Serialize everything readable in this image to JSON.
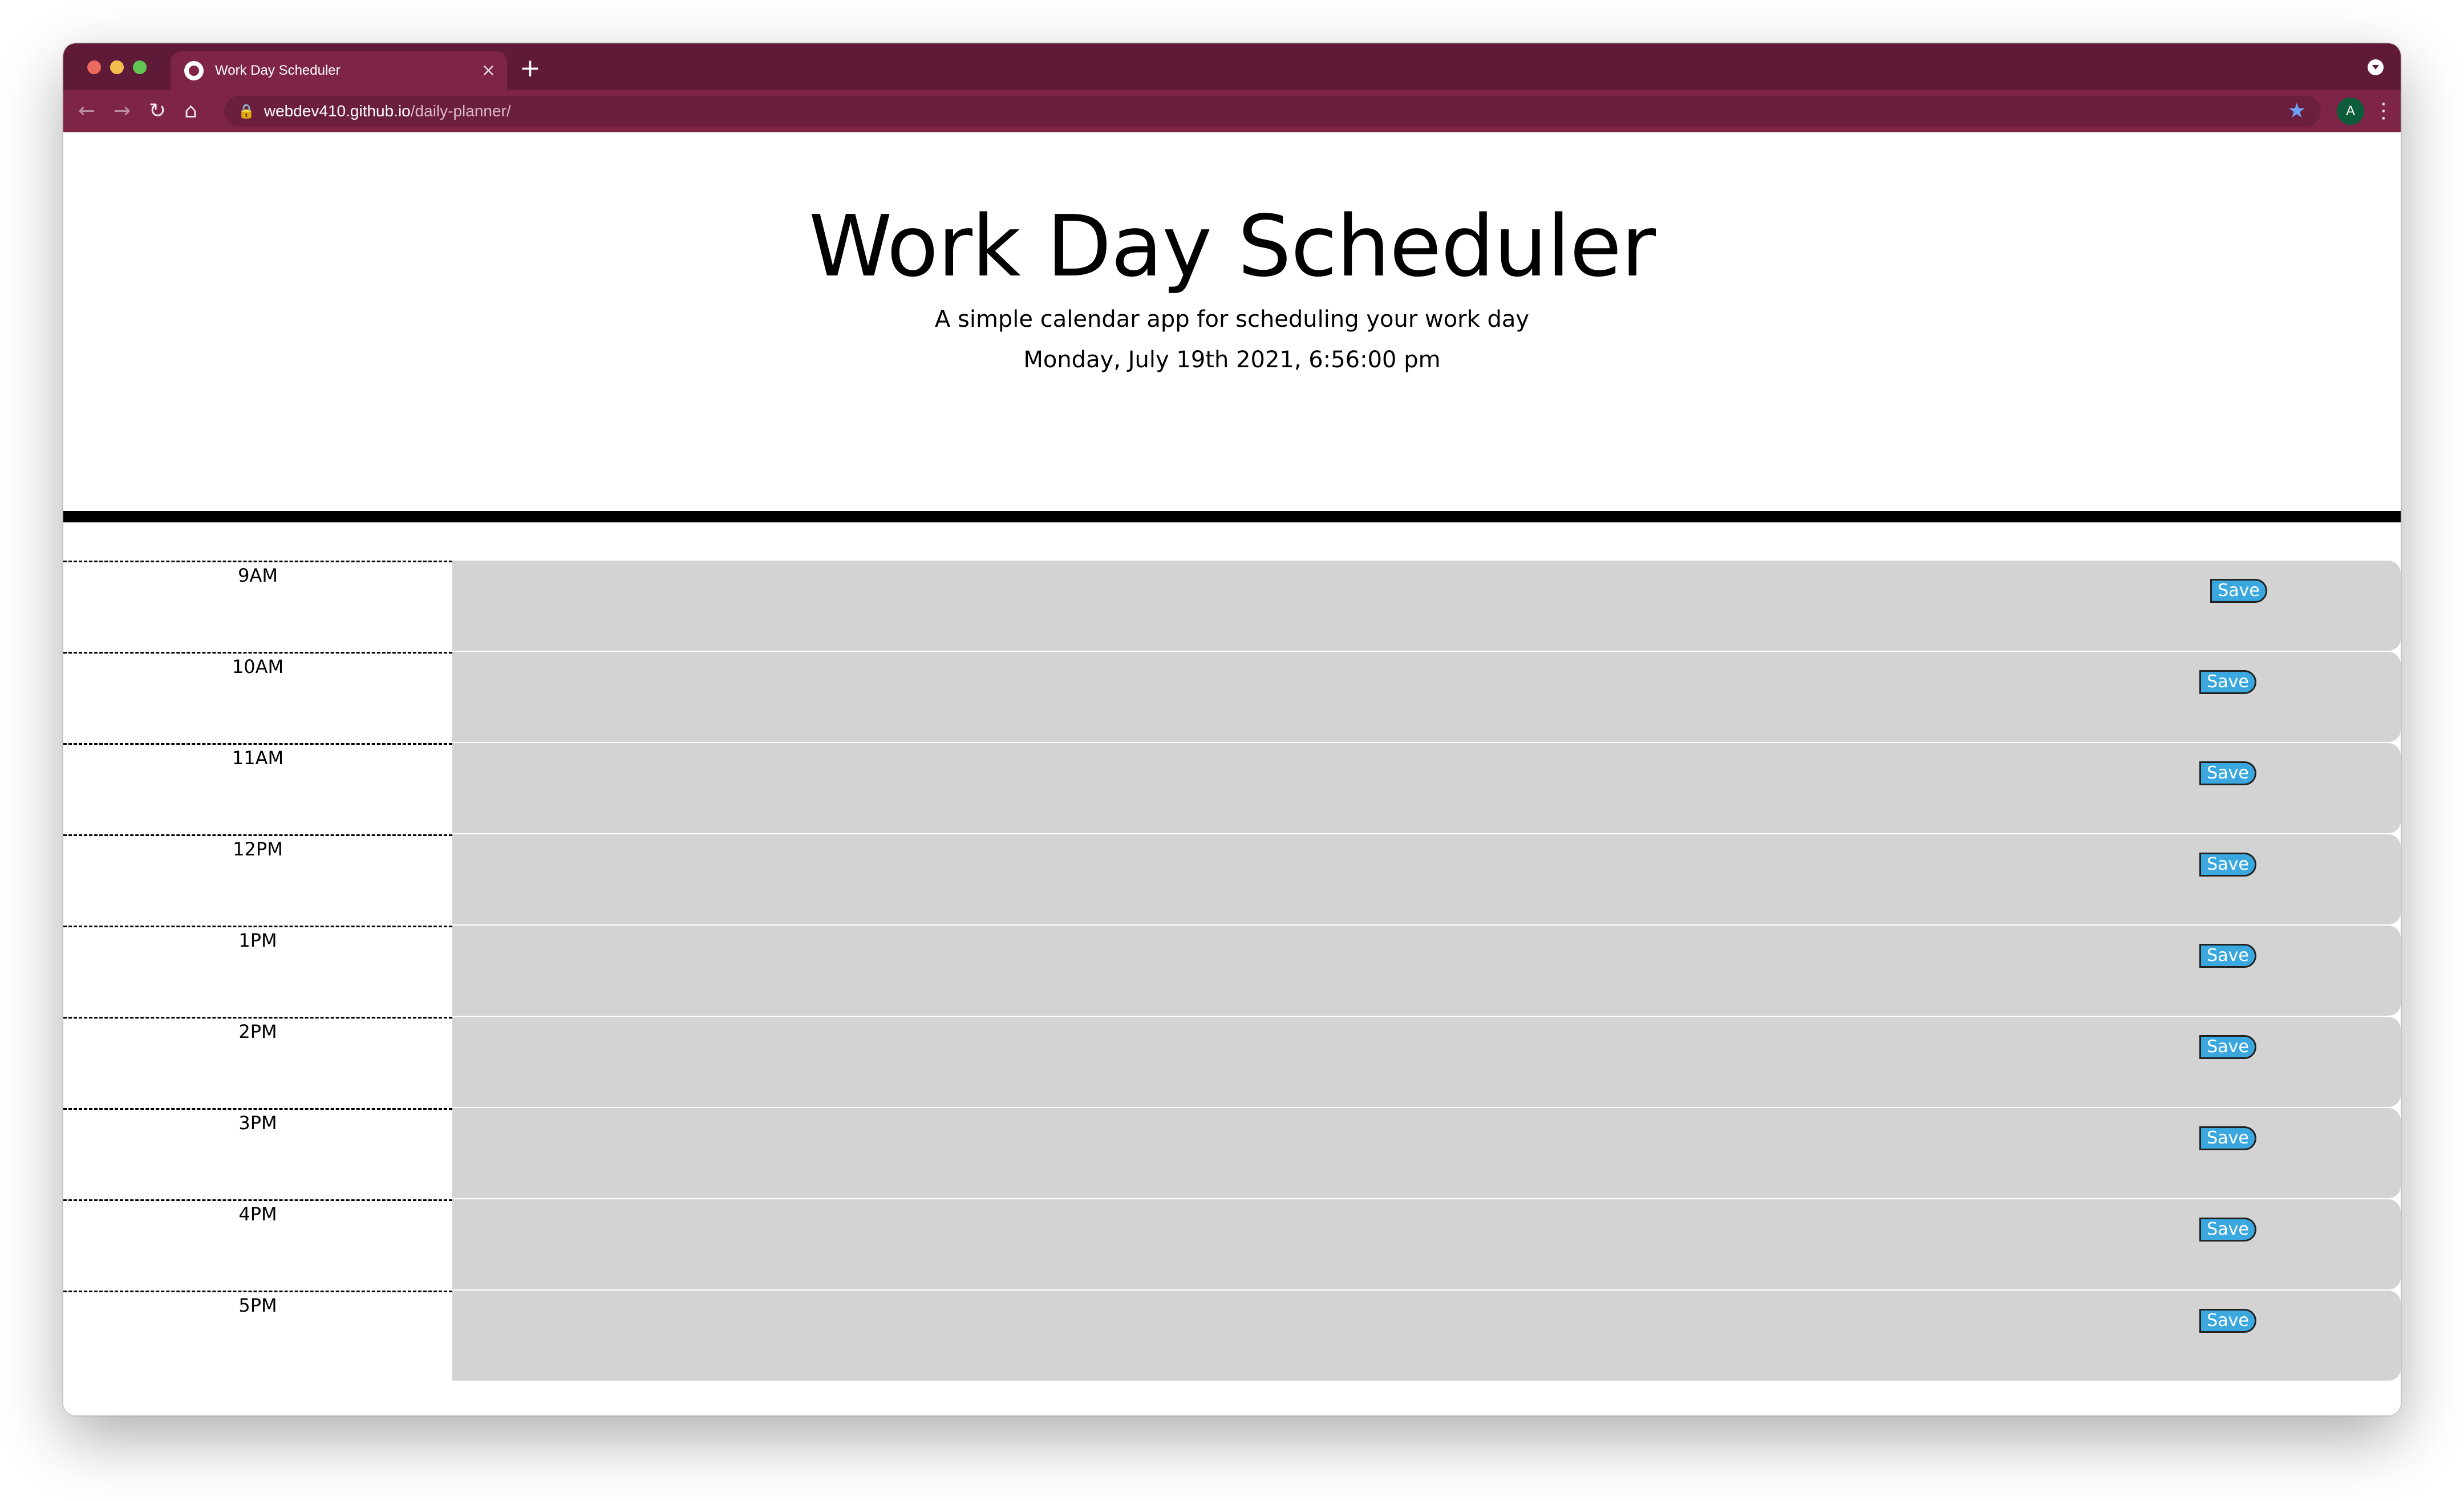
{
  "browser": {
    "tab_title": "Work Day Scheduler",
    "tab_close": "×",
    "new_tab": "+",
    "url_host": "webdev410.github.io",
    "url_path": "/daily-planner/",
    "avatar_letter": "A"
  },
  "header": {
    "title": "Work Day Scheduler",
    "subtitle": "A simple calendar app for scheduling your work day",
    "current_day": "Monday, July 19th 2021, 6:56:00 pm"
  },
  "schedule": {
    "save_label": "Save",
    "blocks": [
      {
        "hour": "9AM"
      },
      {
        "hour": "10AM"
      },
      {
        "hour": "11AM"
      },
      {
        "hour": "12PM"
      },
      {
        "hour": "1PM"
      },
      {
        "hour": "2PM"
      },
      {
        "hour": "3PM"
      },
      {
        "hour": "4PM"
      },
      {
        "hour": "5PM"
      }
    ]
  },
  "colors": {
    "tabstrip": "#5e1a36",
    "toolbar": "#7d2447",
    "block_bg": "#d3d3d3",
    "save_button": "#3aa8df"
  },
  "icons": {
    "back": "arrow-left-icon",
    "forward": "arrow-right-icon",
    "reload": "reload-icon",
    "home": "home-icon",
    "lock": "lock-icon",
    "bookmark": "star-icon",
    "menu": "kebab-menu-icon"
  }
}
